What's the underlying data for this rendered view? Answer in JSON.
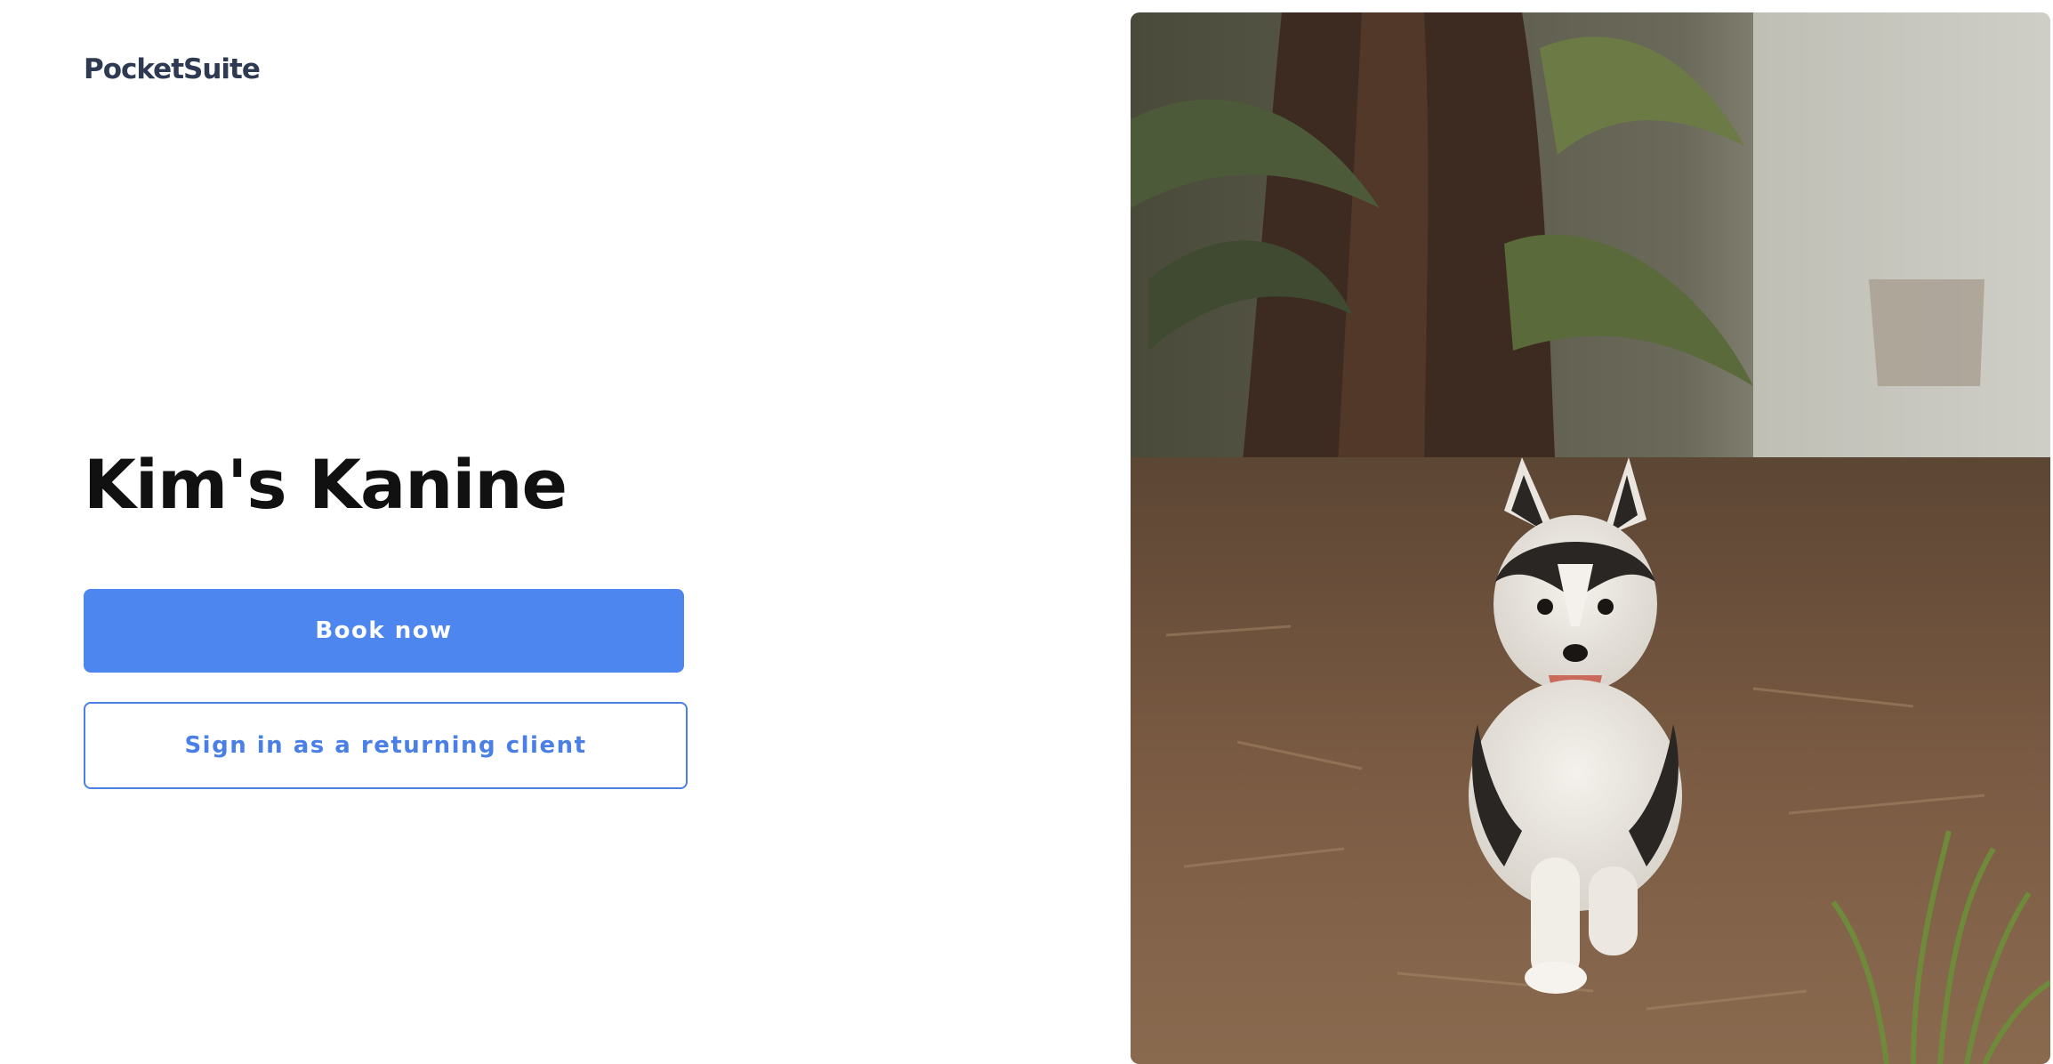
{
  "header": {
    "logo_text": "PocketSuite"
  },
  "main": {
    "business_name": "Kim's Kanine",
    "book_button_label": "Book now",
    "signin_button_label": "Sign in as a returning client"
  },
  "colors": {
    "primary": "#4e86ef",
    "primary_text": "#ffffff",
    "outline": "#4a7fe6",
    "heading": "#111111",
    "logo": "#2d3a52"
  },
  "hero_image": {
    "icon": "husky-puppy-photo"
  }
}
